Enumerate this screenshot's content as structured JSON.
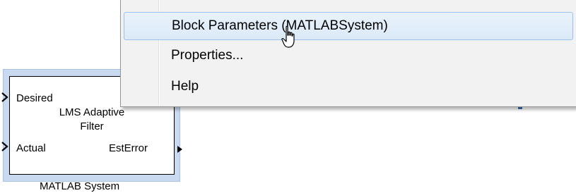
{
  "context_menu": {
    "items": [
      {
        "label": "Block Parameters (MATLABSystem)",
        "highlighted": true
      },
      {
        "label": "Properties..."
      },
      {
        "label": "Help"
      }
    ]
  },
  "block": {
    "input_ports": [
      "Desired",
      "Actual"
    ],
    "output_ports": [
      "EstError"
    ],
    "title_line1": "LMS Adaptive",
    "title_line2": "Filter",
    "caption": "MATLAB System"
  },
  "colors": {
    "selection_halo": "#c9daf0",
    "menu_background": "#f2f2f2",
    "menu_highlight": "#dbe9f8",
    "menu_highlight_border": "#99c1ea"
  },
  "icons": {
    "input_arrow": "chevron-right-icon",
    "output_arrow": "triangle-right-icon",
    "cursor": "mouse-pointer-icon"
  }
}
